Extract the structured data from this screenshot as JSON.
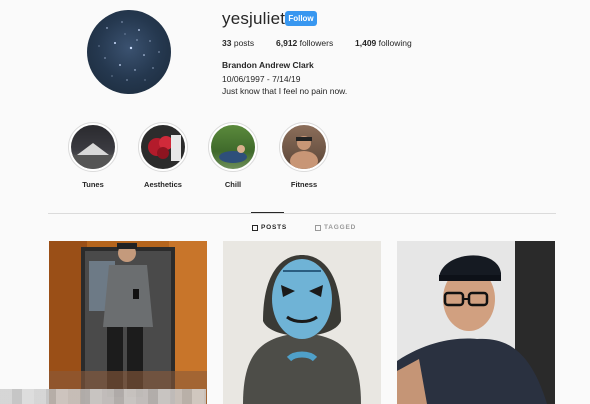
{
  "profile": {
    "username": "yesjuliet",
    "follow_label": "Follow",
    "posts_count": "33",
    "posts_label": "posts",
    "followers_count": "6,912",
    "followers_label": "followers",
    "following_count": "1,409",
    "following_label": "following",
    "full_name": "Brandon Andrew Clark",
    "bio_line1": "10/06/1997 - 7/14/19",
    "bio_line2": "Just know that I feel no pain now.",
    "avatar_icon": "starry-night-avatar"
  },
  "highlights": [
    {
      "label": "Tunes"
    },
    {
      "label": "Aesthetics"
    },
    {
      "label": "Chill"
    },
    {
      "label": "Fitness"
    }
  ],
  "tabs": {
    "posts": "POSTS",
    "tagged": "TAGGED"
  },
  "colors": {
    "follow_button": "#3897f0",
    "background": "#fafafa",
    "text": "#262626"
  }
}
